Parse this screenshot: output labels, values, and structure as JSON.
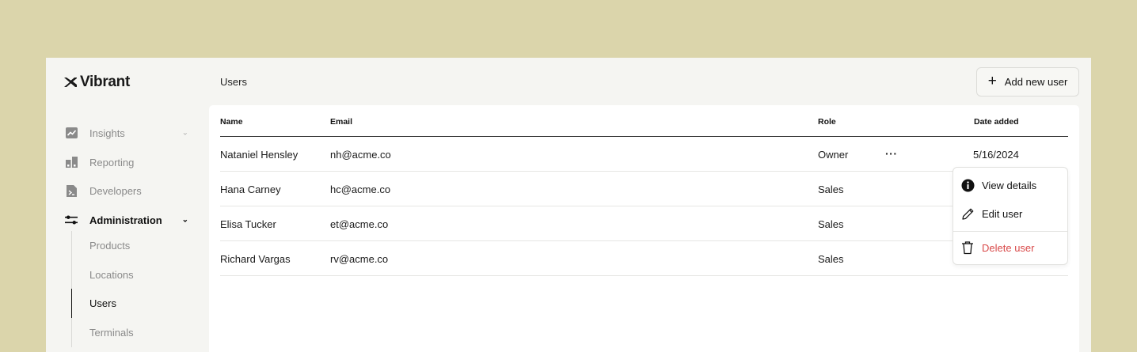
{
  "brand": {
    "name": "Vibrant"
  },
  "sidebar": {
    "items": [
      {
        "label": "Insights",
        "icon": "chart-line-icon",
        "chevron": "⌄"
      },
      {
        "label": "Reporting",
        "icon": "bar-chart-icon"
      },
      {
        "label": "Developers",
        "icon": "terminal-icon"
      },
      {
        "label": "Administration",
        "icon": "sliders-icon",
        "chevron": "⌄"
      }
    ],
    "subitems": [
      {
        "label": "Products"
      },
      {
        "label": "Locations"
      },
      {
        "label": "Users"
      },
      {
        "label": "Terminals"
      }
    ]
  },
  "header": {
    "title": "Users",
    "add_label": "Add new user",
    "add_icon": "+"
  },
  "table": {
    "columns": [
      "Name",
      "Email",
      "Role",
      "Date added"
    ],
    "rows": [
      {
        "name": "Nataniel Hensley",
        "email": "nh@acme.co",
        "role": "Owner",
        "date": "5/16/2024"
      },
      {
        "name": "Hana Carney",
        "email": "hc@acme.co",
        "role": "Sales",
        "date": ""
      },
      {
        "name": "Elisa Tucker",
        "email": "et@acme.co",
        "role": "Sales",
        "date": ""
      },
      {
        "name": "Richard Vargas",
        "email": "rv@acme.co",
        "role": "Sales",
        "date": ""
      }
    ],
    "row_menu_glyph": "···"
  },
  "row_menu": {
    "items": [
      {
        "label": "View details",
        "icon": "info-icon"
      },
      {
        "label": "Edit user",
        "icon": "pencil-icon"
      },
      {
        "label": "Delete user",
        "icon": "trash-icon"
      }
    ]
  },
  "colors": {
    "background": "#dbd5ab",
    "app": "#f5f5f2",
    "panel": "#ffffff",
    "danger": "#d94a4a"
  }
}
